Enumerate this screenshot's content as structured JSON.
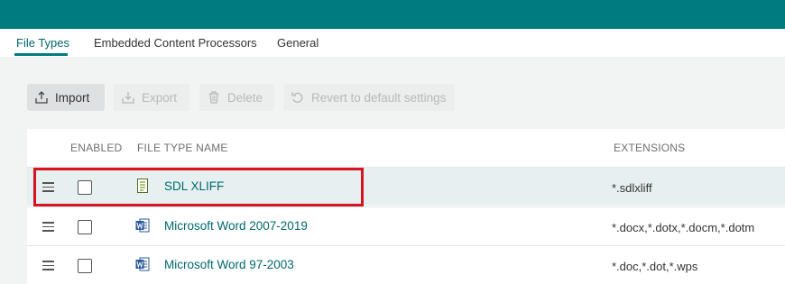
{
  "tabs": [
    {
      "label": "File Types",
      "active": true
    },
    {
      "label": "Embedded Content Processors",
      "active": false
    },
    {
      "label": "General",
      "active": false
    }
  ],
  "toolbar": {
    "import_label": "Import",
    "export_label": "Export",
    "delete_label": "Delete",
    "revert_label": "Revert to default settings"
  },
  "grid": {
    "headers": {
      "enabled": "ENABLED",
      "name": "FILE TYPE NAME",
      "extensions": "EXTENSIONS"
    },
    "rows": [
      {
        "name": "SDL XLIFF",
        "extensions": "*.sdlxliff",
        "enabled": false,
        "icon": "xliff-file-icon",
        "selected": true
      },
      {
        "name": "Microsoft Word 2007-2019",
        "extensions": "*.docx,*.dotx,*.docm,*.dotm",
        "enabled": false,
        "icon": "word-icon",
        "selected": false
      },
      {
        "name": "Microsoft Word 97-2003",
        "extensions": "*.doc,*.dot,*.wps",
        "enabled": false,
        "icon": "word-icon",
        "selected": false
      }
    ]
  },
  "colors": {
    "accent": "#007b7e",
    "link": "#00686b",
    "highlight": "#d7141f"
  }
}
